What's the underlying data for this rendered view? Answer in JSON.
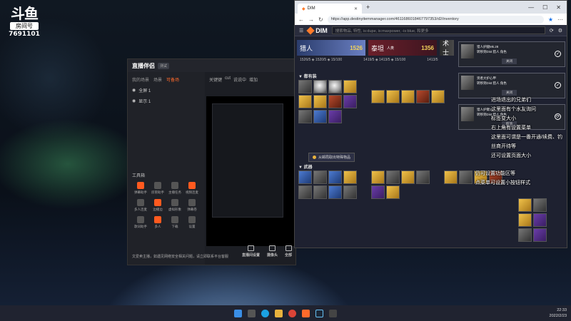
{
  "overlay": {
    "logo": "斗鱼",
    "room_tag": "房间号",
    "room_number": "7691101"
  },
  "app": {
    "title": "直播伴侣",
    "version": "测试",
    "tabs": [
      "我的场景",
      "场景",
      "可备场"
    ],
    "layers": [
      "全屏 1",
      "显示 1"
    ],
    "right_tabs": [
      "关键键",
      "cut",
      "说说中",
      "增加"
    ],
    "preview_text": "正在录制中",
    "tools_title": "工具箱",
    "tools": [
      "弹幕助手",
      "房管助手",
      "主播任务",
      "视频连麦",
      "多人连麦",
      "边播边",
      "虚拟形象",
      "弹幕卷",
      "歌词助手",
      "多人",
      "下载",
      "设置"
    ],
    "bottom": [
      "直播间设置",
      "摄像头",
      "全部"
    ],
    "warning": "文爱卖主播，如遇见网络安全相关问题，请立即联系平台客服"
  },
  "browser": {
    "tab_title": "DIM",
    "url": "https://app.destinyitemmanager.com/4611686018467797353/d2/inventory",
    "search_placeholder": "搜索物品, 特性, is:dupe, is:maxpower, -is:blue, 和更多",
    "characters": [
      {
        "name": "猎人",
        "power": "1526",
        "class": "c1"
      },
      {
        "name": "泰坦",
        "sub": "人类",
        "power": "1356",
        "class": "c2"
      },
      {
        "name": "术士",
        "power": "",
        "class": "c3"
      }
    ],
    "stats": [
      "1526/5 ◈ 1520/5 ◈ 15/100",
      "1419/5 ◈ 1413/5 ◈ 15/100",
      "1413/5"
    ],
    "section_armor": "▼ 都有装",
    "section_weapons": "▼ 武器",
    "vault_button": "从邮局取出特殊物品"
  },
  "notifications": [
    {
      "title": "猎人护腿Mk.28",
      "line2": "转移到Dist 猎人 角色",
      "button": "关闭"
    },
    {
      "title": "贤者大护心甲",
      "line2": "转移到Dist 猎人 角色",
      "button": "关闭"
    },
    {
      "title": "猎人护臂1",
      "line2": "转移到Dist 猎人 角色",
      "button": "取消"
    }
  ],
  "chat_lines": [
    "进场退出的兄弟们",
    "这里面有个水友询问",
    "标签变大小",
    "右上角有设置菜单",
    "这里面可谓是一番开通/续费、钓",
    "丝商开待等",
    "还可设置页面大小"
  ],
  "chat_lines_2": [
    "仍可设置功能区等",
    "点菜单可设置小按钮样式"
  ],
  "taskbar": {
    "time": "22:33",
    "date": "2022/2/23"
  }
}
